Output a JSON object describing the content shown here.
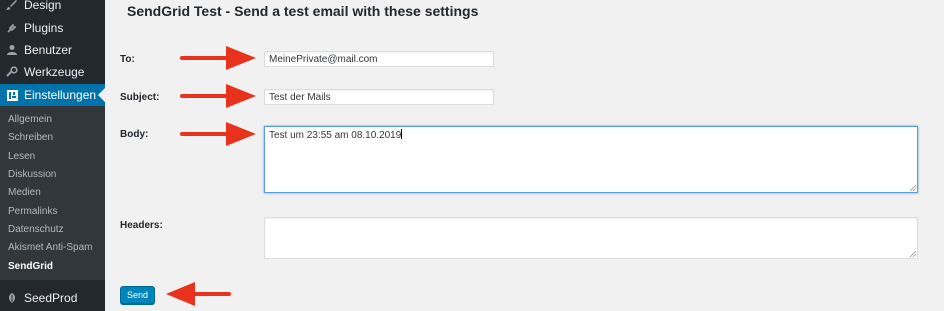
{
  "sidebar": {
    "menu": [
      {
        "label": "Design",
        "icon": "paintbrush-icon"
      },
      {
        "label": "Plugins",
        "icon": "plugin-icon"
      },
      {
        "label": "Benutzer",
        "icon": "user-icon"
      },
      {
        "label": "Werkzeuge",
        "icon": "wrench-icon"
      },
      {
        "label": "Einstellungen",
        "icon": "settings-icon",
        "active": true
      }
    ],
    "submenu": [
      "Allgemein",
      "Schreiben",
      "Lesen",
      "Diskussion",
      "Medien",
      "Permalinks",
      "Datenschutz",
      "Akismet Anti-Spam",
      "SendGrid"
    ],
    "current_submenu": "SendGrid",
    "bottom_item": {
      "label": "SeedProd",
      "icon": "seedprod-icon"
    }
  },
  "main": {
    "title": "SendGrid Test - Send a test email with these settings",
    "fields": {
      "to": {
        "label": "To:",
        "value": "MeinePrivate@mail.com"
      },
      "subject": {
        "label": "Subject:",
        "value": "Test der Mails"
      },
      "body": {
        "label": "Body:",
        "value": "Test um 23:55 am 08.10.2019"
      },
      "headers": {
        "label": "Headers:",
        "value": ""
      }
    },
    "send_label": "Send"
  },
  "colors": {
    "sidebar_bg": "#23282d",
    "submenu_bg": "#32373c",
    "active_bg": "#0073aa",
    "button_bg": "#0085ba",
    "arrow": "#e8321c"
  }
}
